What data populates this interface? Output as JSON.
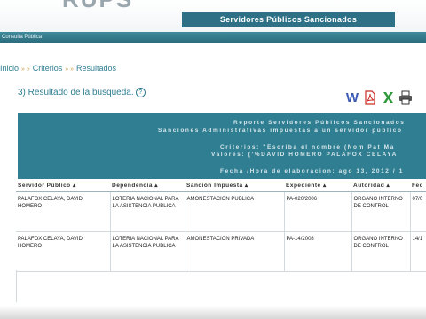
{
  "header": {
    "logo": "RUPS",
    "title": "Servidores Públicos Sancionados"
  },
  "nav": {
    "label": "Consulta Pública"
  },
  "breadcrumbs": [
    "Inicio",
    "Criterios",
    "Resultados"
  ],
  "section": {
    "title": "3) Resultado de la busqueda.",
    "help": "?"
  },
  "export_icons": [
    "word-icon",
    "pdf-icon",
    "excel-icon",
    "print-icon"
  ],
  "report": {
    "line1": "Reporte Servidores Públicos Sancionados",
    "line2": "Sanciones Administrativas impuestas a un servidor público",
    "line3": "Criterios: \"Escriba el nombre (Nom Pat Ma",
    "line4": "Valores: {'%DAVID HOMERO PALAFOX CELAYA",
    "line5": "Fecha /Hora de elaboracion: ago 13, 2012 / 1"
  },
  "table": {
    "columns": [
      "Servidor Público ▴",
      "Dependencia ▴",
      "Sanción Impuesta ▴",
      "Expediente ▴",
      "Autoridad ▴",
      "Fec"
    ],
    "rows": [
      [
        "PALAFOX CELAYA, DAVID HOMERO",
        "LOTERIA NACIONAL PARA LA ASISTENCIA PUBLICA",
        "AMONESTACION PUBLICA",
        "PA-020/2006",
        "ORGANO INTERNO DE CONTROL",
        "07/0"
      ],
      [
        "PALAFOX CELAYA, DAVID HOMERO",
        "LOTERIA NACIONAL PARA LA ASISTENCIA PUBLICA",
        "AMONESTACION PRIVADA",
        "PA-14/2008",
        "ORGANO INTERNO DE CONTROL",
        "14/1"
      ]
    ]
  }
}
